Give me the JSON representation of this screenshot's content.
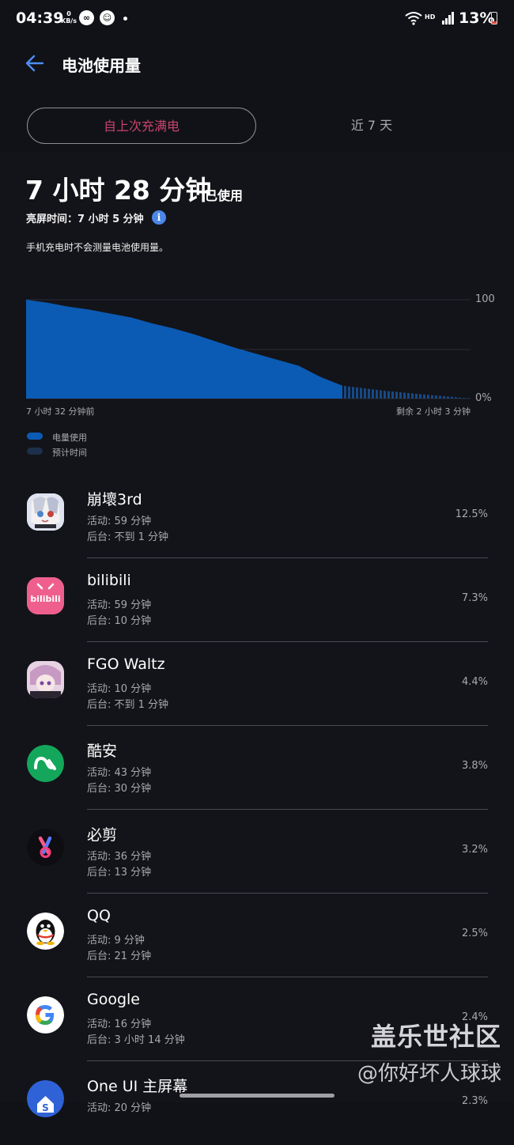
{
  "status_bar": {
    "time": "04:39",
    "net_speed_value": "0",
    "net_speed_unit": "KB/s",
    "network": "HD",
    "battery": "13%"
  },
  "header": {
    "title": "电池使用量"
  },
  "tabs": [
    {
      "label": "自上次充满电",
      "active": true
    },
    {
      "label": "近 7 天",
      "active": false
    }
  ],
  "summary": {
    "usage": "7 小时 28 分钟",
    "usage_suffix": "已使用",
    "screen_time": "亮屏时间：7 小时 5 分钟",
    "note": "手机充电时不会测量电池使用量。"
  },
  "chart_data": {
    "type": "area",
    "series": [
      {
        "name": "电量使用",
        "x": [
          0,
          0.5,
          1,
          1.5,
          2,
          2.5,
          3,
          3.5,
          4,
          4.5,
          5,
          5.5,
          6,
          6.5,
          7,
          7.53
        ],
        "y": [
          100,
          97,
          93,
          90,
          86,
          82,
          76,
          71,
          65,
          58,
          51,
          45,
          39,
          33,
          22,
          13
        ]
      },
      {
        "name": "预计时间",
        "x": [
          7.53,
          8.5,
          9.5,
          10.58
        ],
        "y": [
          13,
          8,
          4,
          0
        ]
      }
    ],
    "y_ticks": [
      "100",
      "0%"
    ],
    "ylim": [
      0,
      100
    ],
    "x_start_label": "7 小时 32 分钟前",
    "x_end_label": "剩余 2 小时 3 分钟",
    "colors": {
      "used": "#0b5bb5",
      "predicted": "#164a88"
    }
  },
  "legend": {
    "used": "电量使用",
    "predicted": "预计时间"
  },
  "apps": [
    {
      "name": "崩壞3rd",
      "active": "活动: 59 分钟",
      "background": "后台: 不到 1 分钟",
      "percent": "12.5%",
      "icon": "honkai-impact-icon"
    },
    {
      "name": "bilibili",
      "active": "活动: 59 分钟",
      "background": "后台: 10 分钟",
      "percent": "7.3%",
      "icon": "bilibili-icon",
      "icon_text": "bilibili"
    },
    {
      "name": "FGO Waltz",
      "active": "活动: 10 分钟",
      "background": "后台: 不到 1 分钟",
      "percent": "4.4%",
      "icon": "fgo-waltz-icon"
    },
    {
      "name": "酷安",
      "active": "活动: 43 分钟",
      "background": "后台: 30 分钟",
      "percent": "3.8%",
      "icon": "coolapk-icon"
    },
    {
      "name": "必剪",
      "active": "活动: 36 分钟",
      "background": "后台: 13 分钟",
      "percent": "3.2%",
      "icon": "bicut-icon"
    },
    {
      "name": "QQ",
      "active": "活动: 9 分钟",
      "background": "后台: 21 分钟",
      "percent": "2.5%",
      "icon": "qq-penguin-icon"
    },
    {
      "name": "Google",
      "active": "活动: 16 分钟",
      "background": "后台: 3 小时 14 分钟",
      "percent": "2.4%",
      "icon": "google-icon"
    },
    {
      "name": "One UI 主屏幕",
      "active": "活动: 20 分钟",
      "background": "",
      "percent": "2.3%",
      "icon": "one-ui-home-icon"
    }
  ],
  "watermark": {
    "line1": "盖乐世社区",
    "line2": "@你好坏人球球"
  }
}
